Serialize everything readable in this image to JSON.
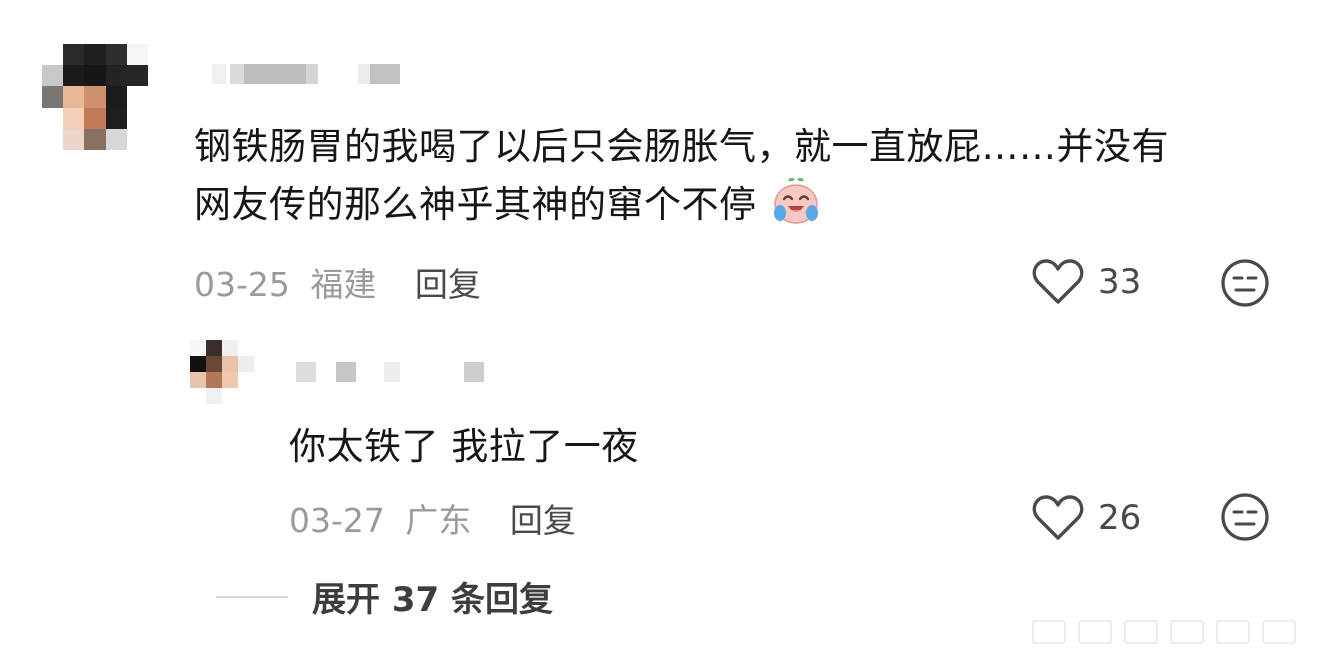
{
  "main_comment": {
    "avatar_pixels": [
      "#ffffff",
      "#2a2a2a",
      "#1e1e1e",
      "#2e2e2e",
      "#f5f5f5",
      "#c8c8c8",
      "#1b1b1b",
      "#161616",
      "#242424",
      "#262626",
      "#7a7672",
      "#e8b896",
      "#d09070",
      "#1c1c1c",
      "#ffffff",
      "#ffffff",
      "#f2d0b8",
      "#c07a58",
      "#1e1e1e",
      "#ffffff",
      "#ffffff",
      "#ead7ca",
      "#8a7060",
      "#d7d7d7",
      "#ffffff"
    ],
    "text_line1": "钢铁肠胃的我喝了以后只会肠胀气，就一直放屁……并没有",
    "text_line2": "网友传的那么神乎其神的窜个不停",
    "emoji_icon": "crying-laughing-baby-emoji",
    "date": "03-25",
    "location": "福建",
    "reply_label": "回复",
    "likes": "33"
  },
  "reply_comment": {
    "avatar_pixels": [
      "#f6f6f6",
      "#3a2e2a",
      "#efefef",
      "#ffffff",
      "#111111",
      "#6a4838",
      "#e9c2a8",
      "#ededed",
      "#e8c4aa",
      "#b07858",
      "#f0c8ac",
      "#ffffff",
      "#ffffff",
      "#f0f0f0",
      "#ffffff",
      "#ffffff"
    ],
    "text": "你太铁了 我拉了一夜",
    "date": "03-27",
    "location": "广东",
    "reply_label": "回复",
    "likes": "26"
  },
  "expand_label": "展开 37 条回复",
  "colors": {
    "meta_gray": "#9a9a9a",
    "icon_gray": "#4a4a4a",
    "text_dark": "#161616"
  },
  "icons": {
    "like": "heart-outline-icon",
    "dislike": "meh-face-icon"
  }
}
